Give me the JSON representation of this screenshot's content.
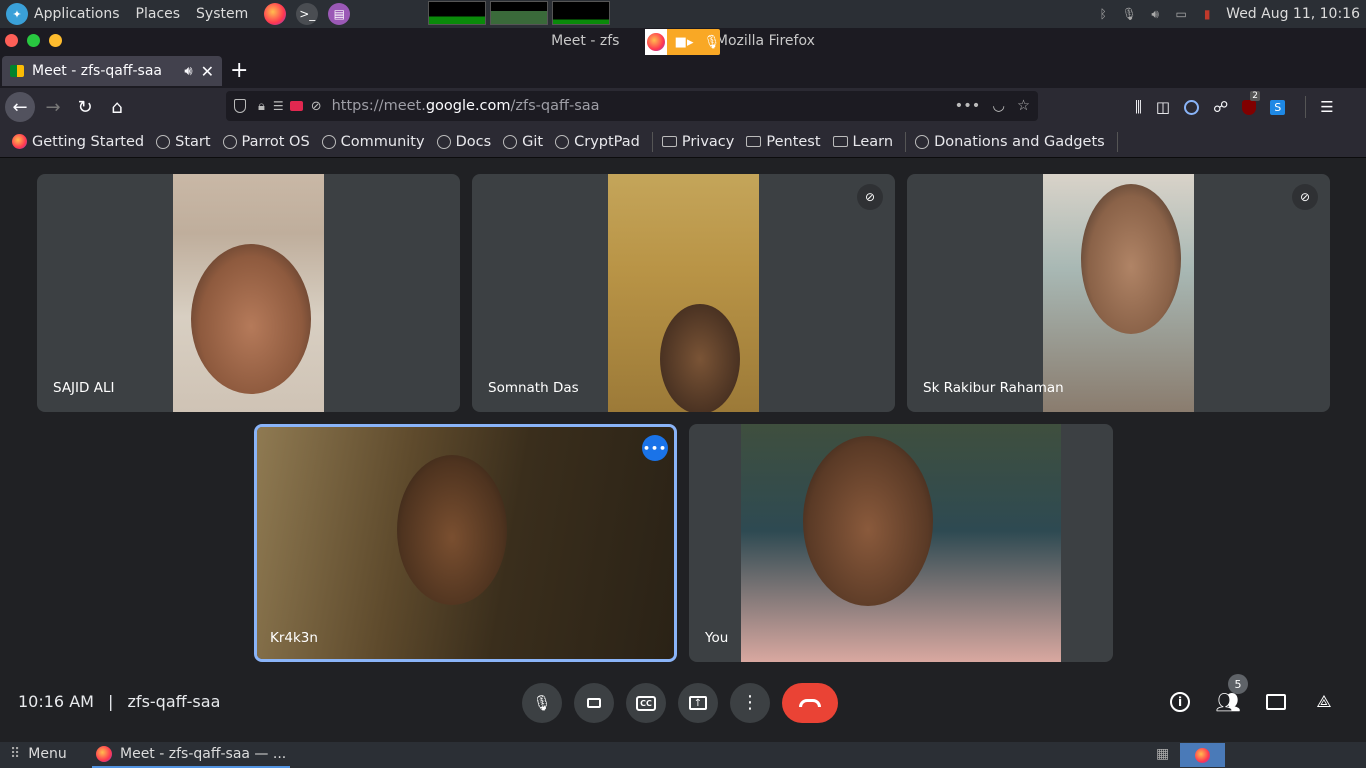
{
  "os": {
    "menu": [
      "Applications",
      "Places",
      "System"
    ],
    "datetime": "Wed Aug 11, 10:16"
  },
  "browser": {
    "window_title_prefix": "Meet - zfs",
    "window_title_suffix": "— Mozilla Firefox",
    "tab_title": "Meet - zfs-qaff-saa",
    "url_host_prefix": "https://meet.",
    "url_host_main": "google.com",
    "url_path": "/zfs-qaff-saa",
    "ublock_count": "2",
    "bookmarks": [
      "Getting Started",
      "Start",
      "Parrot OS",
      "Community",
      "Docs",
      "Git",
      "CryptPad"
    ],
    "bookmark_folders": [
      "Privacy",
      "Pentest",
      "Learn"
    ],
    "bookmark_last": "Donations and Gadgets"
  },
  "meet": {
    "participants": [
      {
        "name": "SAJID ALI",
        "muted": false
      },
      {
        "name": "Somnath Das",
        "muted": true
      },
      {
        "name": "Sk Rakibur Rahaman",
        "muted": true
      },
      {
        "name": "Kr4k3n",
        "muted": false
      },
      {
        "name": "You",
        "muted": false
      }
    ],
    "time": "10:16 AM",
    "separator": "|",
    "meeting_code": "zfs-qaff-saa",
    "people_count": "5"
  },
  "taskbar": {
    "menu_label": "Menu",
    "window_label": "Meet - zfs-qaff-saa — ..."
  },
  "colors": {
    "accent_blue": "#8ab4f8",
    "hangup_red": "#ea4335",
    "indicator_orange": "#f9a825",
    "tile_bg": "#3c4043"
  }
}
